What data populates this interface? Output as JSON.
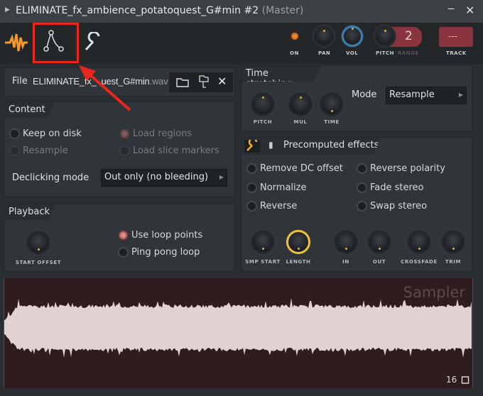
{
  "window": {
    "title": "ELIMINATE_fx_ambience_potatoquest_G#min #2",
    "title_suffix": "(Master)",
    "minimize": "‒",
    "close": "✕"
  },
  "toolbar": {
    "on_label": "ON",
    "pan_label": "PAN",
    "vol_label": "VOL",
    "pitch_label": "PITCH",
    "range_label": "RANGE",
    "range_value": "2",
    "track_label": "TRACK",
    "track_value": "---"
  },
  "file": {
    "label": "File",
    "name": "ELIMINATE_fx_",
    "name_rest": "uest_G#min",
    "ext": ".wav"
  },
  "content": {
    "title": "Content",
    "options": [
      {
        "label": "Keep on disk",
        "checked": false,
        "enabled": true
      },
      {
        "label": "Load regions",
        "checked": true,
        "enabled": false
      },
      {
        "label": "Resample",
        "checked": false,
        "enabled": false
      },
      {
        "label": "Load slice markers",
        "checked": false,
        "enabled": false
      }
    ],
    "declicking_label": "Declicking mode",
    "declicking_value": "Out only (no bleeding)"
  },
  "playback": {
    "title": "Playback",
    "knob": "START OFFSET",
    "options": [
      {
        "label": "Use loop points",
        "checked": true
      },
      {
        "label": "Ping pong loop",
        "checked": false
      }
    ]
  },
  "time_stretching": {
    "title": "Time stretching",
    "knobs": [
      "PITCH",
      "MUL",
      "TIME"
    ],
    "mode_label": "Mode",
    "mode_value": "Resample"
  },
  "precomputed": {
    "title": "Precomputed effects",
    "options": [
      "Remove DC offset",
      "Reverse polarity",
      "Normalize",
      "Fade stereo",
      "Reverse",
      "Swap stereo"
    ],
    "knobs": [
      "SMP START",
      "LENGTH",
      "IN",
      "OUT",
      "CROSSFADE",
      "TRIM"
    ]
  },
  "waveform": {
    "watermark": "Sampler",
    "bits": "16"
  },
  "colors": {
    "accent": "#f59a2a",
    "annotation": "#e8281e",
    "waveform": "#e2d1d3",
    "waveform_bg": "#2e1c1e"
  }
}
